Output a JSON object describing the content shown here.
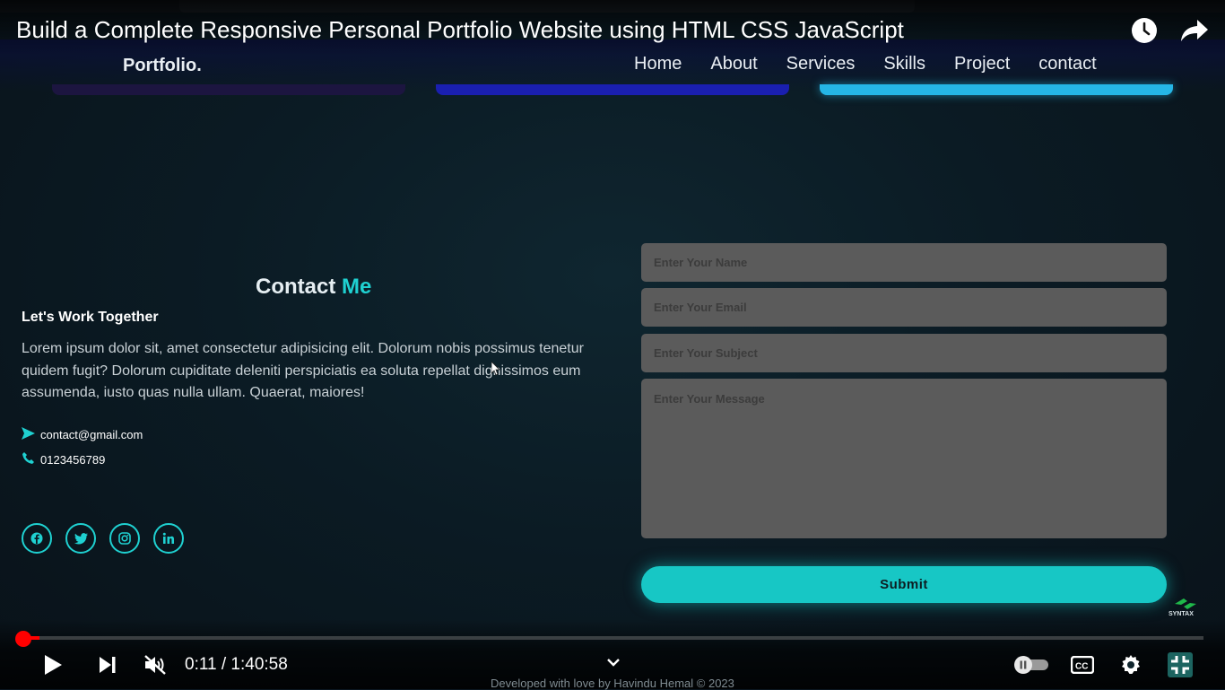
{
  "video": {
    "title": "Build a Complete Responsive Personal Portfolio Website using HTML CSS JavaScript",
    "current_time": "0:11",
    "duration": "1:40:58",
    "time_display": "0:11 / 1:40:58",
    "progress_fraction": 0.0018
  },
  "site": {
    "logo": "Portfolio.",
    "nav": [
      "Home",
      "About",
      "Services",
      "Skills",
      "Project",
      "contact"
    ]
  },
  "contact": {
    "title_main": "Contact",
    "title_accent": "Me",
    "subtitle": "Let's Work Together",
    "description": "Lorem ipsum dolor sit, amet consectetur adipisicing elit. Dolorum nobis possimus tenetur quidem fugit? Dolorum cupiditate deleniti perspiciatis ea soluta repellat dignissimos eum assumenda, iusto quas nulla ullam. Quaerat, maiores!",
    "email": "contact@gmail.com",
    "phone": "0123456789",
    "social_icons": [
      "facebook-icon",
      "twitter-icon",
      "instagram-icon",
      "linkedin-icon"
    ]
  },
  "form": {
    "name_placeholder": "Enter Your Name",
    "email_placeholder": "Enter Your Email",
    "subject_placeholder": "Enter Your Subject",
    "message_placeholder": "Enter Your Message",
    "submit_label": "Submit"
  },
  "brand": {
    "name": "SYNTAX"
  },
  "footer": {
    "text": "Developed with love by Havindu Hemal © 2023"
  },
  "colors": {
    "accent": "#1fd1d1",
    "progress": "#ff0000",
    "field": "#5b5b5b"
  }
}
